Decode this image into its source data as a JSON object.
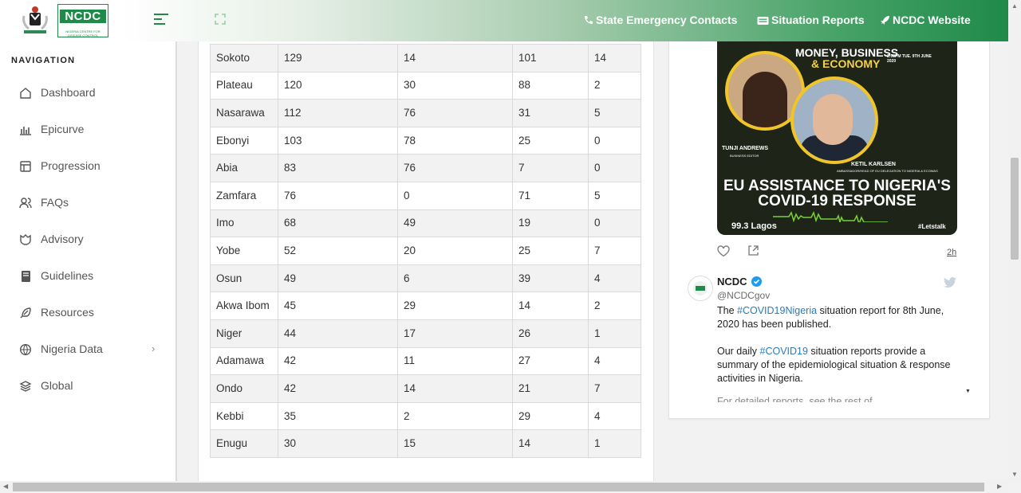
{
  "header": {
    "logo_text": "NCDC",
    "logo_subtitle": "NIGERIA CENTRE FOR DISEASE CONTROL",
    "links": [
      "State Emergency Contacts",
      "Situation Reports",
      "NCDC Website"
    ]
  },
  "sidebar": {
    "title": "NAVIGATION",
    "items": [
      {
        "label": "Dashboard",
        "icon": "home-icon"
      },
      {
        "label": "Epicurve",
        "icon": "bar-chart-icon"
      },
      {
        "label": "Progression",
        "icon": "layout-icon"
      },
      {
        "label": "FAQs",
        "icon": "users-icon"
      },
      {
        "label": "Advisory",
        "icon": "advisory-icon"
      },
      {
        "label": "Guidelines",
        "icon": "book-icon"
      },
      {
        "label": "Resources",
        "icon": "feather-icon"
      },
      {
        "label": "Nigeria Data",
        "icon": "globe-icon",
        "has_submenu": true
      },
      {
        "label": "Global",
        "icon": "layers-icon"
      }
    ]
  },
  "table": {
    "rows": [
      [
        "Sokoto",
        "129",
        "14",
        "101",
        "14"
      ],
      [
        "Plateau",
        "120",
        "30",
        "88",
        "2"
      ],
      [
        "Nasarawa",
        "112",
        "76",
        "31",
        "5"
      ],
      [
        "Ebonyi",
        "103",
        "78",
        "25",
        "0"
      ],
      [
        "Abia",
        "83",
        "76",
        "7",
        "0"
      ],
      [
        "Zamfara",
        "76",
        "0",
        "71",
        "5"
      ],
      [
        "Imo",
        "68",
        "49",
        "19",
        "0"
      ],
      [
        "Yobe",
        "52",
        "20",
        "25",
        "7"
      ],
      [
        "Osun",
        "49",
        "6",
        "39",
        "4"
      ],
      [
        "Akwa Ibom",
        "45",
        "29",
        "14",
        "2"
      ],
      [
        "Niger",
        "44",
        "17",
        "26",
        "1"
      ],
      [
        "Adamawa",
        "42",
        "11",
        "27",
        "4"
      ],
      [
        "Ondo",
        "42",
        "14",
        "21",
        "7"
      ],
      [
        "Kebbi",
        "35",
        "2",
        "29",
        "4"
      ],
      [
        "Enugu",
        "30",
        "15",
        "14",
        "1"
      ]
    ]
  },
  "tweet_media": {
    "heading_line1": "MONEY, BUSINESS",
    "heading_line2": "& ECONOMY",
    "air_time": "2:00PM TUE. 9TH JUNE 2020",
    "person1_name": "TUNJI ANDREWS",
    "person1_title": "BUSINESS EDITOR",
    "person2_name": "KETIL KARLSEN",
    "person2_title": "AMBASSADOR/HEAD OF EU DELEGATION TO NIGERIA & ECOWAS",
    "headline_line1": "EU ASSISTANCE TO NIGERIA'S",
    "headline_line2": "COVID-19 RESPONSE",
    "frequency": "99.3 Lagos",
    "hashtag": "#Letstalk",
    "age": "2h"
  },
  "tweet": {
    "name": "NCDC",
    "handle": "@NCDCgov",
    "p1_pre": "The ",
    "p1_tag": "#COVID19Nigeria",
    "p1_post": " situation report for 8th June, 2020 has been published.",
    "p2_pre": "Our daily ",
    "p2_tag": "#COVID19",
    "p2_post": " situation reports provide a summary of the epidemiological situation & response activities in Nigeria.",
    "p3_partial": "For detailed reports, see the rest of..."
  },
  "colors": {
    "brand_green": "#1f8a4a",
    "link_blue": "#2b7bb9",
    "accent_yellow": "#f3d24a"
  }
}
